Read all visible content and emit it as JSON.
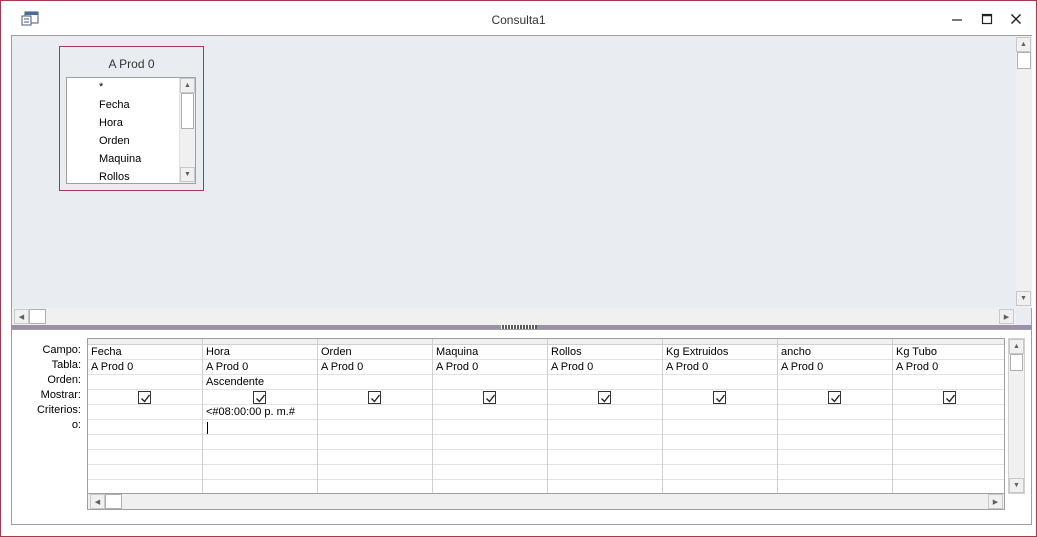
{
  "window": {
    "title": "Consulta1",
    "app_icon": "access-query-icon",
    "minimize_icon": "minimize-icon",
    "maximize_icon": "maximize-icon",
    "close_icon": "close-icon"
  },
  "table_box": {
    "title": "A Prod 0",
    "fields": [
      "*",
      "Fecha",
      "Hora",
      "Orden",
      "Maquina",
      "Rollos"
    ]
  },
  "qbe": {
    "row_labels": [
      "Campo:",
      "Tabla:",
      "Orden:",
      "Mostrar:",
      "Criterios:",
      "o:"
    ],
    "columns": [
      {
        "campo": "Fecha",
        "tabla": "A Prod 0",
        "orden": "",
        "mostrar": true,
        "criterios": "",
        "o": ""
      },
      {
        "campo": "Hora",
        "tabla": "A Prod 0",
        "orden": "Ascendente",
        "mostrar": true,
        "criterios": "<#08:00:00 p. m.#",
        "o": ""
      },
      {
        "campo": "Orden",
        "tabla": "A Prod 0",
        "orden": "",
        "mostrar": true,
        "criterios": "",
        "o": ""
      },
      {
        "campo": "Maquina",
        "tabla": "A Prod 0",
        "orden": "",
        "mostrar": true,
        "criterios": "",
        "o": ""
      },
      {
        "campo": "Rollos",
        "tabla": "A Prod 0",
        "orden": "",
        "mostrar": true,
        "criterios": "",
        "o": ""
      },
      {
        "campo": "Kg Extruidos",
        "tabla": "A Prod 0",
        "orden": "",
        "mostrar": true,
        "criterios": "",
        "o": ""
      },
      {
        "campo": "ancho",
        "tabla": "A Prod 0",
        "orden": "",
        "mostrar": true,
        "criterios": "",
        "o": ""
      },
      {
        "campo": "Kg Tubo",
        "tabla": "A Prod 0",
        "orden": "",
        "mostrar": true,
        "criterios": "",
        "o": ""
      }
    ]
  },
  "colors": {
    "border_accent": "#a33a4d",
    "design_background": "#e9ecf0",
    "splitter": "#9c90a8"
  }
}
